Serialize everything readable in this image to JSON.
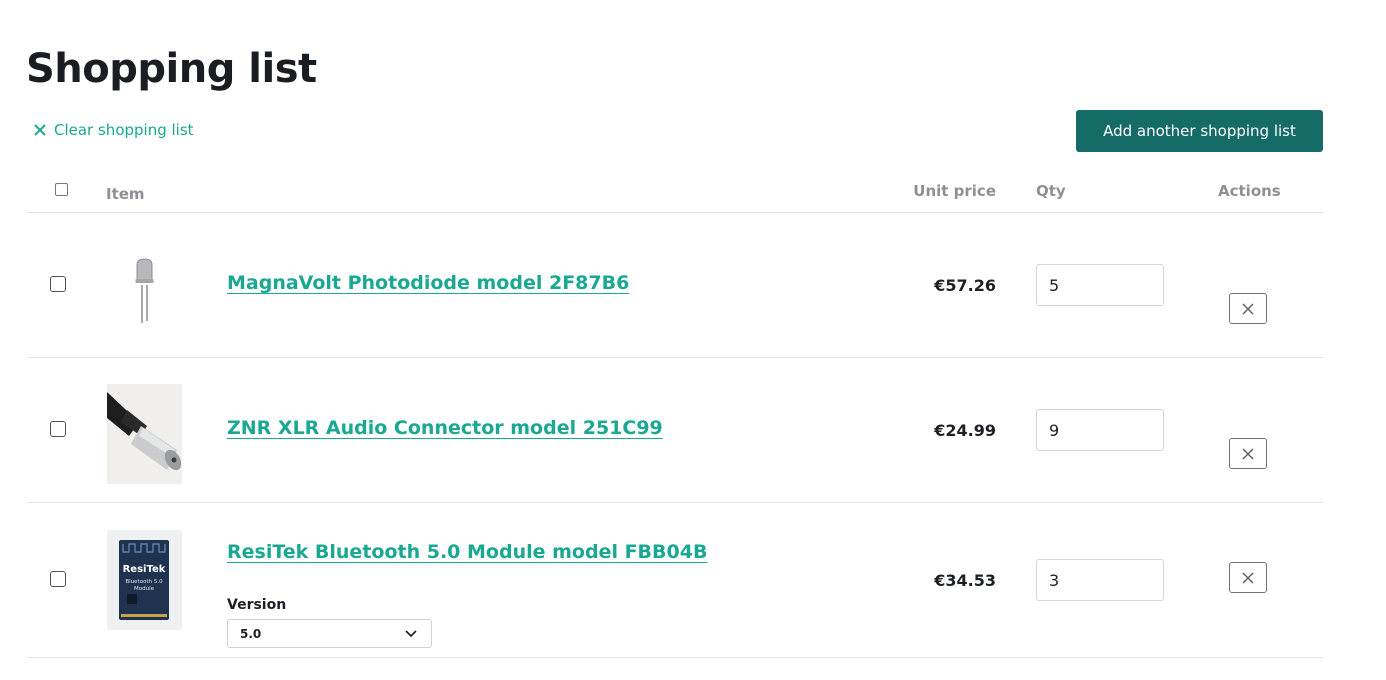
{
  "page": {
    "title": "Shopping list"
  },
  "toolbar": {
    "clear_label": "Clear shopping list",
    "add_label": "Add another shopping list"
  },
  "table": {
    "headers": {
      "item": "Item",
      "unit_price": "Unit price",
      "qty": "Qty",
      "actions": "Actions"
    },
    "rows": [
      {
        "name": "MagnaVolt Photodiode model 2F87B6",
        "price": "€57.26",
        "qty": "5",
        "thumb_icon": "photodiode-image"
      },
      {
        "name": "ZNR XLR Audio Connector model 251C99",
        "price": "€24.99",
        "qty": "9",
        "thumb_icon": "xlr-connector-image"
      },
      {
        "name": "ResiTek Bluetooth 5.0 Module model FBB04B",
        "price": "€34.53",
        "qty": "3",
        "thumb_icon": "bluetooth-module-image",
        "thumb_text": {
          "brand": "ResiTek",
          "line1": "Bluetooth 5.0",
          "line2": "Module"
        },
        "version": {
          "label": "Version",
          "value": "5.0"
        }
      }
    ]
  },
  "colors": {
    "accent": "#1aa892",
    "button": "#156b68",
    "muted": "#8d9196"
  }
}
